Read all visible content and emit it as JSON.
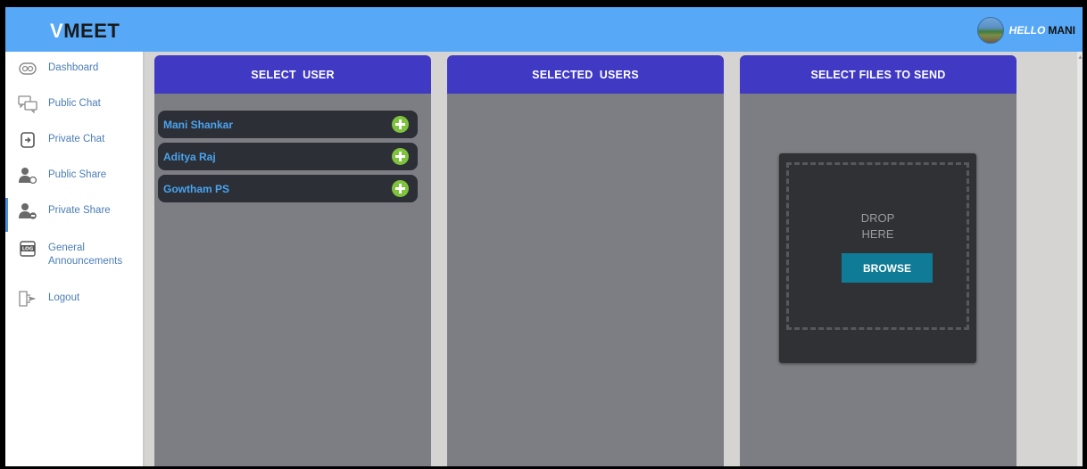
{
  "header": {
    "logo_v": "V",
    "logo_rest": "MEET",
    "hello": "HELLO",
    "user_name": "MANI"
  },
  "sidebar": {
    "items": [
      {
        "label": "Dashboard",
        "icon": "dashboard-icon"
      },
      {
        "label": "Public Chat",
        "icon": "chat-bubbles-icon"
      },
      {
        "label": "Private Chat",
        "icon": "private-chat-icon"
      },
      {
        "label": "Public Share",
        "icon": "public-share-icon"
      },
      {
        "label": "Private Share",
        "icon": "private-share-icon",
        "active": true
      },
      {
        "label": "General\nAnnouncements",
        "icon": "log-icon"
      },
      {
        "label": "Logout",
        "icon": "logout-icon"
      }
    ]
  },
  "columns": {
    "select_user": "SELECT  USER",
    "selected_users": "SELECTED  USERS",
    "select_files": "SELECT FILES TO SEND"
  },
  "users": [
    {
      "name": "Mani Shankar"
    },
    {
      "name": "Aditya Raj"
    },
    {
      "name": "Gowtham PS"
    }
  ],
  "dropzone": {
    "text": "DROP\nHERE",
    "browse_label": "BROWSE"
  },
  "colors": {
    "header": "#57a8f7",
    "column_head": "#3f39c4",
    "column_body": "#7c7e83",
    "add_button": "#7ec23e",
    "browse_button": "#0f7b96"
  }
}
